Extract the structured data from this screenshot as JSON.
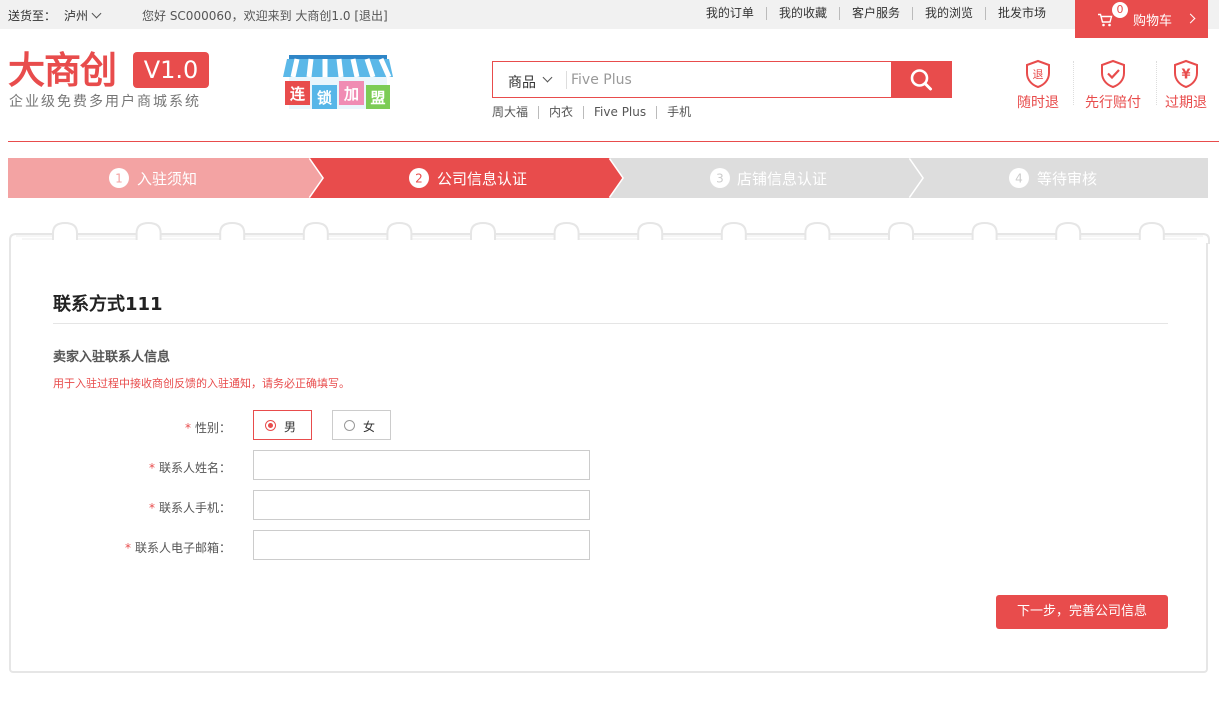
{
  "topbar": {
    "deliver_to_label": "送货至：",
    "city": "泸州",
    "welcome": "您好 SC000060，欢迎来到 大商创1.0 [退出]",
    "links": [
      "我的订单",
      "我的收藏",
      "客户服务",
      "我的浏览",
      "批发市场"
    ],
    "cart_label": "购物车",
    "cart_count": "0"
  },
  "logo": {
    "brand": "大商创",
    "version": "V1.0",
    "slogan": "企业级免费多用户商城系统"
  },
  "franchise": {
    "chars": [
      "连",
      "锁",
      "加",
      "盟"
    ]
  },
  "search": {
    "category": "商品",
    "placeholder": "Five Plus",
    "hot_words": [
      "周大福",
      "内衣",
      "Five Plus",
      "手机"
    ]
  },
  "services": [
    "随时退",
    "先行赔付",
    "过期退"
  ],
  "steps": [
    {
      "num": "1",
      "label": "入驻须知",
      "state": "done"
    },
    {
      "num": "2",
      "label": "公司信息认证",
      "state": "active"
    },
    {
      "num": "3",
      "label": "店铺信息认证",
      "state": "todo"
    },
    {
      "num": "4",
      "label": "等待审核",
      "state": "todo"
    }
  ],
  "colors": {
    "accent": "#e84c4c",
    "step_done": "#f3a3a3",
    "step_todo": "#dddddd"
  },
  "form": {
    "title": "联系方式111",
    "subhead": "卖家入驻联系人信息",
    "notice": "用于入驻过程中接收商创反馈的入驻通知，请务必正确填写。",
    "gender_label": "性别：",
    "gender_options": [
      "男",
      "女"
    ],
    "gender_selected": "男",
    "name_label": "联系人姓名：",
    "name_value": "",
    "phone_label": "联系人手机：",
    "phone_value": "",
    "email_label": "联系人电子邮箱：",
    "email_value": "",
    "required_mark": "*",
    "next_button": "下一步，完善公司信息"
  }
}
